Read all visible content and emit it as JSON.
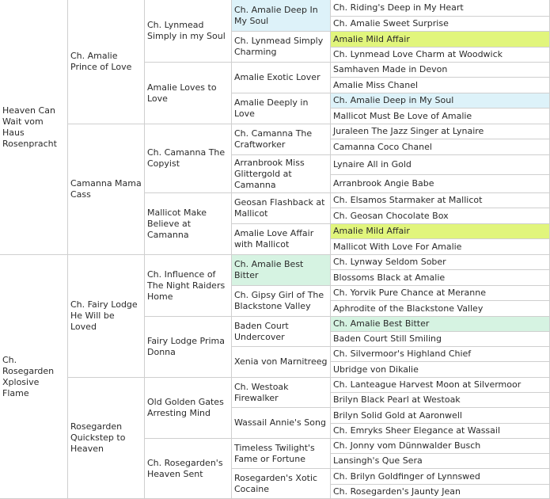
{
  "pedigree": {
    "gen1": [
      "Heaven Can Wait vom Haus Rosenpracht",
      "Ch. Rosegarden Xplosive Flame"
    ],
    "gen2": [
      "Ch. Amalie Prince of Love",
      "Camanna Mama Cass",
      "Ch. Fairy Lodge He Will be Loved",
      "Rosegarden Quickstep to Heaven"
    ],
    "gen3": [
      "Ch. Lynmead Simply in my Soul",
      "Amalie Loves to Love",
      "Ch. Camanna The Copyist",
      "Mallicot Make Believe at Camanna",
      "Ch. Influence of The Night Raiders Home",
      "Fairy Lodge Prima Donna",
      "Old Golden Gates Arresting Mind",
      "Ch. Rosegarden's Heaven Sent"
    ],
    "gen4": [
      "Ch. Amalie Deep In My Soul",
      "Ch. Lynmead Simply Charming",
      "Amalie Exotic Lover",
      "Amalie Deeply in Love",
      "Ch. Camanna The Craftworker",
      "Arranbrook Miss Glittergold at Camanna",
      "Geosan Flashback at Mallicot",
      "Amalie Love Affair with Mallicot",
      "Ch. Amalie Best Bitter",
      "Ch. Gipsy Girl of The Blackstone Valley",
      "Baden Court Undercover",
      "Xenia von Marnitreeg",
      "Ch. Westoak Firewalker",
      "Wassail Annie's Song",
      "Timeless Twilight's Fame or Fortune",
      "Rosegarden's Xotic Cocaine"
    ],
    "gen5": [
      "Ch. Riding's Deep in My Heart",
      "Ch. Amalie Sweet Surprise",
      "Amalie Mild Affair",
      "Ch. Lynmead Love Charm at Woodwick",
      "Samhaven Made in Devon",
      "Amalie Miss Chanel",
      "Ch. Amalie Deep in My Soul",
      "Mallicot Must Be Love of Amalie",
      "Juraleen The Jazz Singer at Lynaire",
      "Camanna Coco Chanel",
      "Lynaire All in Gold",
      "Arranbrook Angie Babe",
      "Ch. Elsamos Starmaker at Mallicot",
      "Ch. Geosan Chocolate Box",
      "Amalie Mild Affair",
      "Mallicot With Love For Amalie",
      "Ch. Lynway Seldom Sober",
      "Blossoms Black at Amalie",
      "Ch. Yorvik Pure Chance at Meranne",
      "Aphrodite of the Blackstone Valley",
      "Ch. Amalie Best Bitter",
      "Baden Court Still Smiling",
      "Ch. Silvermoor's Highland Chief",
      "Ubridge von Dikalie",
      "Ch. Lanteague Harvest Moon at Silvermoor",
      "Brilyn Black Pearl at Westoak",
      "Brilyn Solid Gold at Aaronwell",
      "Ch. Emryks Sheer Elegance at Wassail",
      "Ch. Jonny vom Dünnwalder Busch",
      "Lansingh's Que Sera",
      "Ch. Brilyn Goldfinger of Lynnswed",
      "Ch. Rosegarden's Jaunty Jean"
    ]
  },
  "highlights": {
    "gen4": {
      "0": "#ddf2f9",
      "8": "#d6f3e2"
    },
    "gen5": {
      "2": "#e1f57c",
      "6": "#ddf2f9",
      "14": "#e1f57c",
      "20": "#d6f3e2"
    }
  },
  "colors": {
    "border": "#cfcfcf",
    "blue_highlight": "#ddf2f9",
    "lime_highlight": "#e1f57c",
    "mint_highlight": "#d6f3e2"
  }
}
